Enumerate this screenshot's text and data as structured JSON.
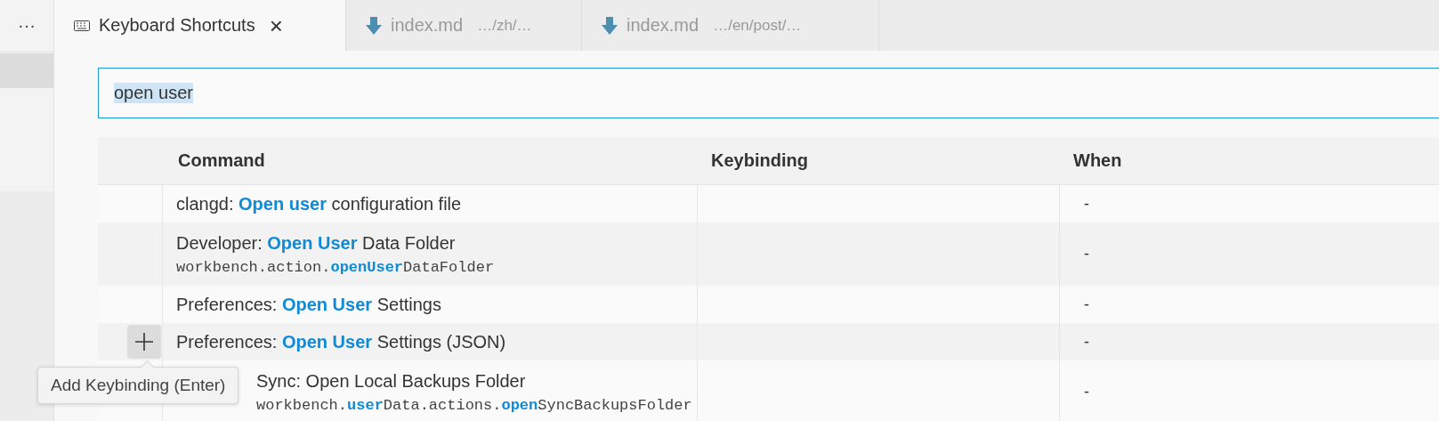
{
  "sidebar": {
    "more_label": "···"
  },
  "tabs": [
    {
      "kind": "keyboard",
      "label": "Keyboard Shortcuts",
      "selected": true,
      "close": "×"
    },
    {
      "kind": "download",
      "label": "index.md",
      "description": "…/zh/…",
      "selected": false
    },
    {
      "kind": "download",
      "label": "index.md",
      "description": "…/en/post/…",
      "selected": false
    }
  ],
  "search": {
    "value": "open user",
    "text_selected": true
  },
  "table": {
    "columns": [
      "Command",
      "Keybinding",
      "When"
    ],
    "rows": [
      {
        "kind": "normal",
        "hovered": false,
        "command": "clangd: **Open user** configuration file",
        "when": "-"
      },
      {
        "kind": "normal",
        "hovered": false,
        "command": "Developer: **Open User** Data Folder",
        "command_id": "workbench.action.**openUser**DataFolder",
        "when": "-"
      },
      {
        "kind": "normal",
        "hovered": false,
        "command": "Preferences: **Open User** Settings",
        "when": "-"
      },
      {
        "kind": "normal",
        "hovered": true,
        "command": "Preferences: **Open User** Settings (JSON)",
        "when": "-"
      },
      {
        "kind": "covered",
        "hovered": false,
        "command": "Sync: Open Local Backups Folder",
        "command_id": "workbench.**user**Data.actions.**open**SyncBackupsFolder",
        "when": "-"
      }
    ]
  },
  "tooltip": {
    "text": "Add Keybinding (Enter)"
  }
}
